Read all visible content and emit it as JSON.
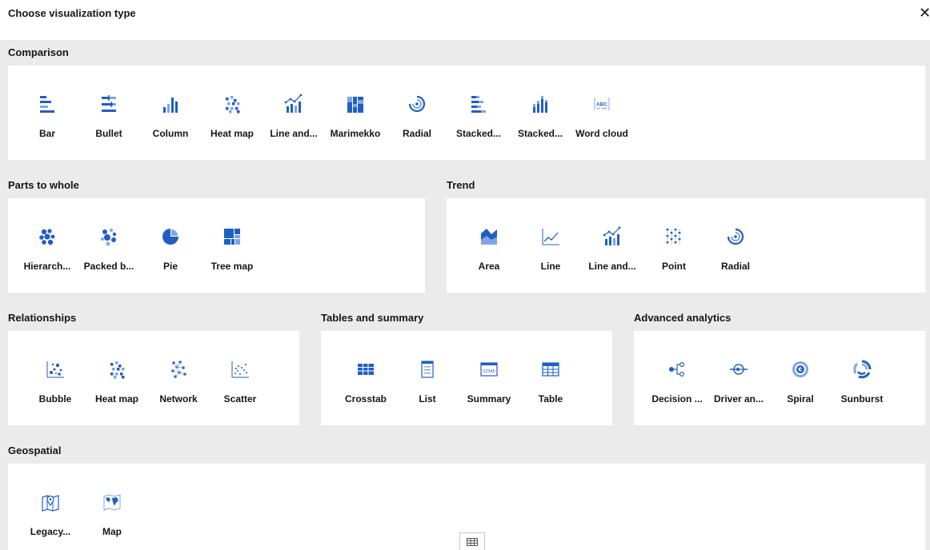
{
  "dialog": {
    "title": "Choose visualization type",
    "close_glyph": "✕"
  },
  "colors": {
    "accent": "#1f5fc4",
    "light": "#7fa5e6",
    "background": "#ebebeb",
    "panel": "#ffffff"
  },
  "sections": {
    "comparison": {
      "title": "Comparison",
      "items": [
        {
          "label": "Bar",
          "icon": "bar-icon"
        },
        {
          "label": "Bullet",
          "icon": "bullet-icon"
        },
        {
          "label": "Column",
          "icon": "column-icon"
        },
        {
          "label": "Heat map",
          "icon": "heat-map-icon"
        },
        {
          "label": "Line and...",
          "icon": "line-and-column-icon"
        },
        {
          "label": "Marimekko",
          "icon": "marimekko-icon"
        },
        {
          "label": "Radial",
          "icon": "radial-icon"
        },
        {
          "label": "Stacked...",
          "icon": "stacked-bar-icon"
        },
        {
          "label": "Stacked...",
          "icon": "stacked-column-icon"
        },
        {
          "label": "Word cloud",
          "icon": "word-cloud-icon",
          "icon_text": "ABC"
        }
      ]
    },
    "parts_to_whole": {
      "title": "Parts to whole",
      "items": [
        {
          "label": "Hierarch...",
          "icon": "hierarchy-bubble-icon"
        },
        {
          "label": "Packed b...",
          "icon": "packed-bubble-icon"
        },
        {
          "label": "Pie",
          "icon": "pie-icon"
        },
        {
          "label": "Tree map",
          "icon": "tree-map-icon"
        }
      ]
    },
    "trend": {
      "title": "Trend",
      "items": [
        {
          "label": "Area",
          "icon": "area-icon"
        },
        {
          "label": "Line",
          "icon": "line-icon"
        },
        {
          "label": "Line and...",
          "icon": "line-and-column-icon"
        },
        {
          "label": "Point",
          "icon": "point-icon"
        },
        {
          "label": "Radial",
          "icon": "radial-icon"
        }
      ]
    },
    "relationships": {
      "title": "Relationships",
      "items": [
        {
          "label": "Bubble",
          "icon": "bubble-icon"
        },
        {
          "label": "Heat map",
          "icon": "heat-map-icon"
        },
        {
          "label": "Network",
          "icon": "network-icon"
        },
        {
          "label": "Scatter",
          "icon": "scatter-icon"
        }
      ]
    },
    "tables": {
      "title": "Tables and summary",
      "items": [
        {
          "label": "Crosstab",
          "icon": "crosstab-icon"
        },
        {
          "label": "List",
          "icon": "list-icon"
        },
        {
          "label": "Summary",
          "icon": "summary-icon",
          "icon_text": "12345"
        },
        {
          "label": "Table",
          "icon": "table-icon"
        }
      ]
    },
    "advanced": {
      "title": "Advanced analytics",
      "items": [
        {
          "label": "Decision ...",
          "icon": "decision-tree-icon"
        },
        {
          "label": "Driver an...",
          "icon": "driver-analysis-icon"
        },
        {
          "label": "Spiral",
          "icon": "spiral-icon"
        },
        {
          "label": "Sunburst",
          "icon": "sunburst-icon"
        }
      ]
    },
    "geospatial": {
      "title": "Geospatial",
      "items": [
        {
          "label": "Legacy...",
          "icon": "legacy-map-icon"
        },
        {
          "label": "Map",
          "icon": "map-icon"
        }
      ]
    }
  }
}
